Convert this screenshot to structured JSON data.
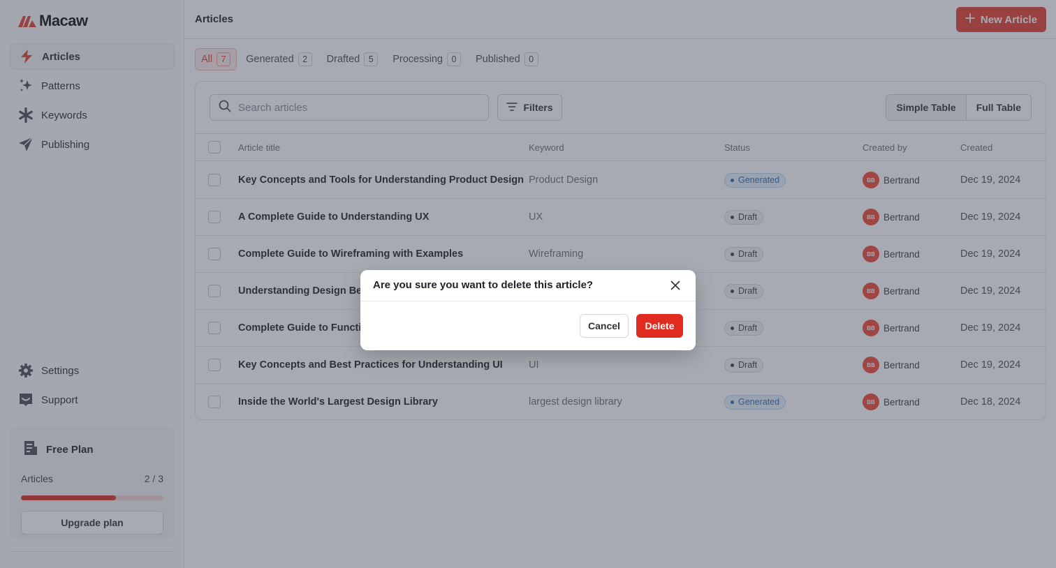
{
  "app": {
    "name": "Macaw",
    "brand_color": "#e54030"
  },
  "sidebar": {
    "nav": [
      {
        "label": "Articles",
        "icon": "bolt-icon",
        "active": true
      },
      {
        "label": "Patterns",
        "icon": "sparkles-icon"
      },
      {
        "label": "Keywords",
        "icon": "asterisk-icon"
      },
      {
        "label": "Publishing",
        "icon": "send-icon"
      }
    ],
    "bottom": [
      {
        "label": "Settings",
        "icon": "gear-icon"
      },
      {
        "label": "Support",
        "icon": "support-icon"
      }
    ],
    "plan": {
      "name": "Free Plan",
      "usage_label": "Articles",
      "usage_value": "2 / 3",
      "usage_fraction": 0.667,
      "upgrade_label": "Upgrade plan"
    }
  },
  "header": {
    "title": "Articles",
    "new_button": "New Article"
  },
  "tabs": [
    {
      "label": "All",
      "count": "7",
      "active": true
    },
    {
      "label": "Generated",
      "count": "2"
    },
    {
      "label": "Drafted",
      "count": "5"
    },
    {
      "label": "Processing",
      "count": "0"
    },
    {
      "label": "Published",
      "count": "0"
    }
  ],
  "toolbar": {
    "search_placeholder": "Search articles",
    "filters_label": "Filters",
    "view_simple": "Simple Table",
    "view_full": "Full Table"
  },
  "table": {
    "columns": [
      "Article title",
      "Keyword",
      "Status",
      "Created by",
      "Created"
    ],
    "rows": [
      {
        "title": "Key Concepts and Tools for Understanding Product Design",
        "keyword": "Product Design",
        "status": "Generated",
        "initials": "BB",
        "author": "Bertrand",
        "created": "Dec 19, 2024"
      },
      {
        "title": "A Complete Guide to Understanding UX",
        "keyword": "UX",
        "status": "Draft",
        "initials": "BB",
        "author": "Bertrand",
        "created": "Dec 19, 2024"
      },
      {
        "title": "Complete Guide to Wireframing with Examples",
        "keyword": "Wireframing",
        "status": "Draft",
        "initials": "BB",
        "author": "Bertrand",
        "created": "Dec 19, 2024"
      },
      {
        "title": "Understanding Design Beyo",
        "keyword": "",
        "status": "Draft",
        "initials": "BB",
        "author": "Bertrand",
        "created": "Dec 19, 2024"
      },
      {
        "title": "Complete Guide to Functiona",
        "keyword": "",
        "status": "Draft",
        "initials": "BB",
        "author": "Bertrand",
        "created": "Dec 19, 2024"
      },
      {
        "title": "Key Concepts and Best Practices for Understanding UI",
        "keyword": "UI",
        "status": "Draft",
        "initials": "BB",
        "author": "Bertrand",
        "created": "Dec 19, 2024"
      },
      {
        "title": "Inside the World's Largest Design Library",
        "keyword": "largest design library",
        "status": "Generated",
        "initials": "BB",
        "author": "Bertrand",
        "created": "Dec 18, 2024"
      }
    ]
  },
  "modal": {
    "title": "Are you sure you want to delete this article?",
    "cancel_label": "Cancel",
    "delete_label": "Delete",
    "close_icon": "close-icon"
  }
}
